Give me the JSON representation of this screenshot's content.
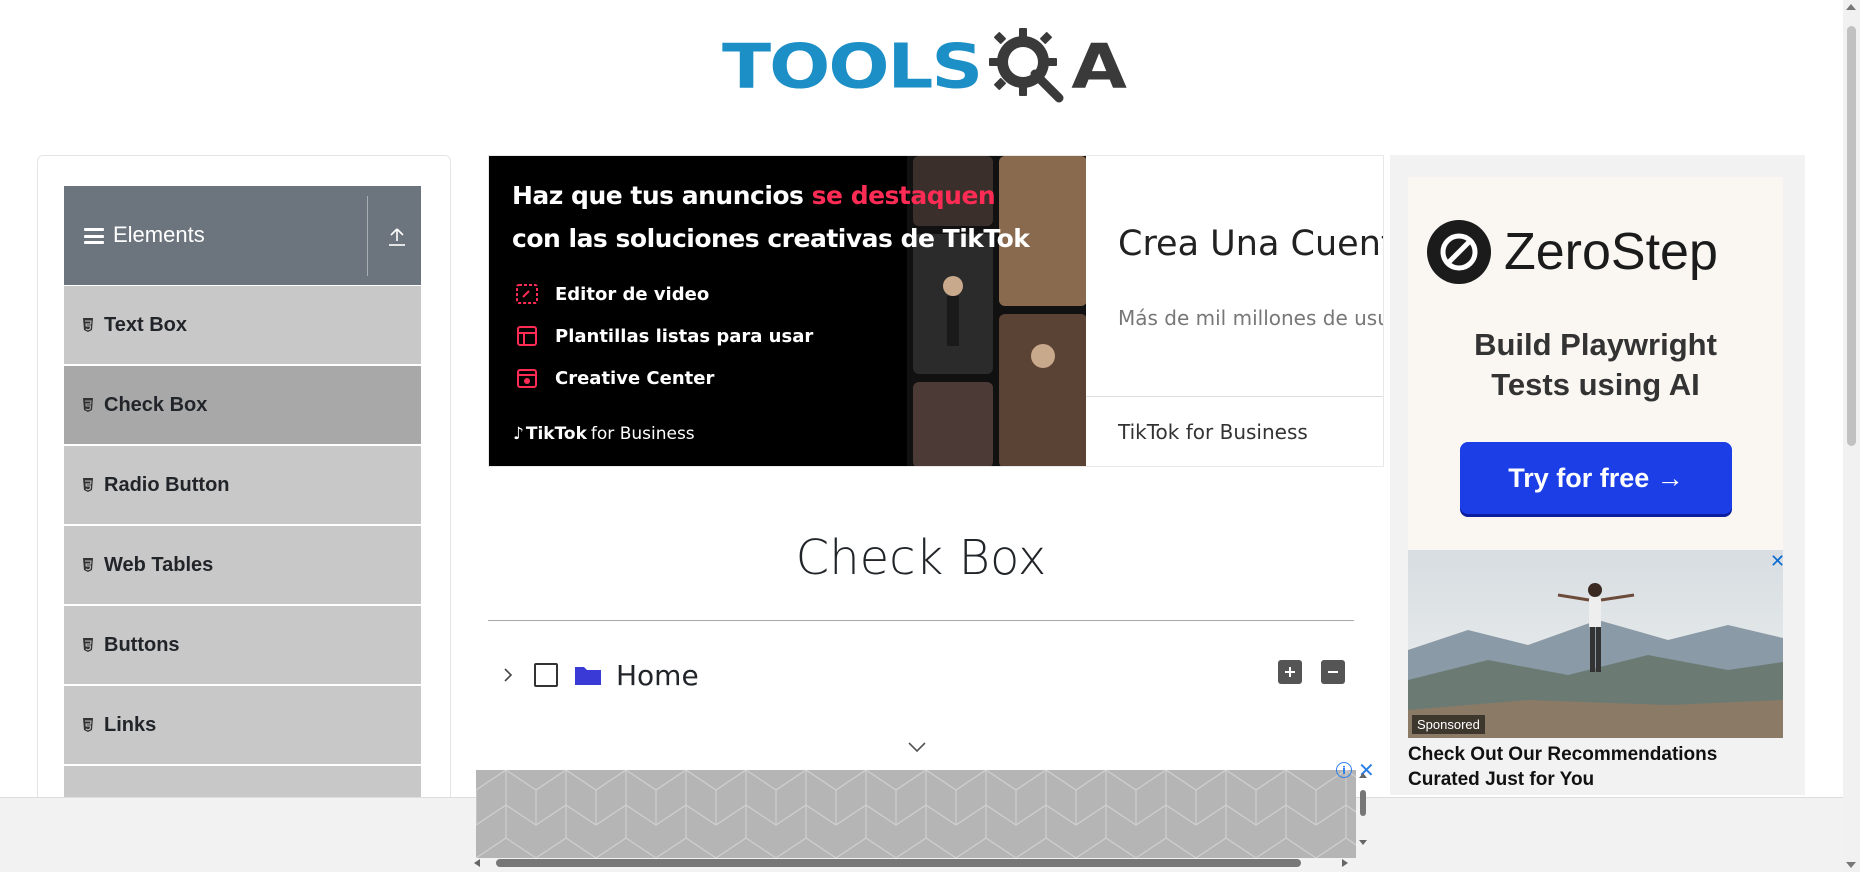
{
  "logo": {
    "text_left": "TOOLS",
    "text_right": "A",
    "icon": "gear-magnifier-icon"
  },
  "sidebar": {
    "group_title": "Elements",
    "group_icon": "hamburger-icon",
    "collapse_icon": "upload-icon",
    "items": [
      {
        "label": "Text Box",
        "icon": "html5-icon",
        "active": false
      },
      {
        "label": "Check Box",
        "icon": "html5-icon",
        "active": true
      },
      {
        "label": "Radio Button",
        "icon": "html5-icon",
        "active": false
      },
      {
        "label": "Web Tables",
        "icon": "html5-icon",
        "active": false
      },
      {
        "label": "Buttons",
        "icon": "html5-icon",
        "active": false
      },
      {
        "label": "Links",
        "icon": "html5-icon",
        "active": false
      }
    ]
  },
  "top_ad": {
    "headline_1": "Haz que tus anuncios ",
    "headline_highlight": "se destaquen",
    "headline_2": "con las soluciones creativas de TikTok",
    "features": [
      "Editor de video",
      "Plantillas listas para usar",
      "Creative Center"
    ],
    "brand_bold": "TikTok",
    "brand_rest": "for Business",
    "cta_title": "Crea Una Cuenta",
    "cta_sub": "Más de mil millones de usua",
    "advertiser": "TikTok for Business",
    "highlight_color": "#fe2c55"
  },
  "main": {
    "title": "Check Box",
    "tree": {
      "root_label": "Home",
      "expand_all_icon": "plus-square-icon",
      "collapse_all_icon": "minus-square-icon"
    }
  },
  "side_ad": {
    "brand": "ZeroStep",
    "tagline_1": "Build Playwright",
    "tagline_2": "Tests using AI",
    "button": "Try for free →",
    "button_color": "#1b3ee6",
    "sponsored": "Sponsored",
    "caption": "Check Out Our Recommendations Curated Just for You",
    "close": "✕"
  },
  "bottom_ad": {
    "info": "i",
    "close": "✕"
  },
  "colors": {
    "sidebar_header": "#6c757d",
    "menu_item": "#c8c8c8",
    "menu_item_active": "#a8a8a8",
    "logo_blue": "#1d8fc7",
    "folder": "#3a3ad6"
  }
}
